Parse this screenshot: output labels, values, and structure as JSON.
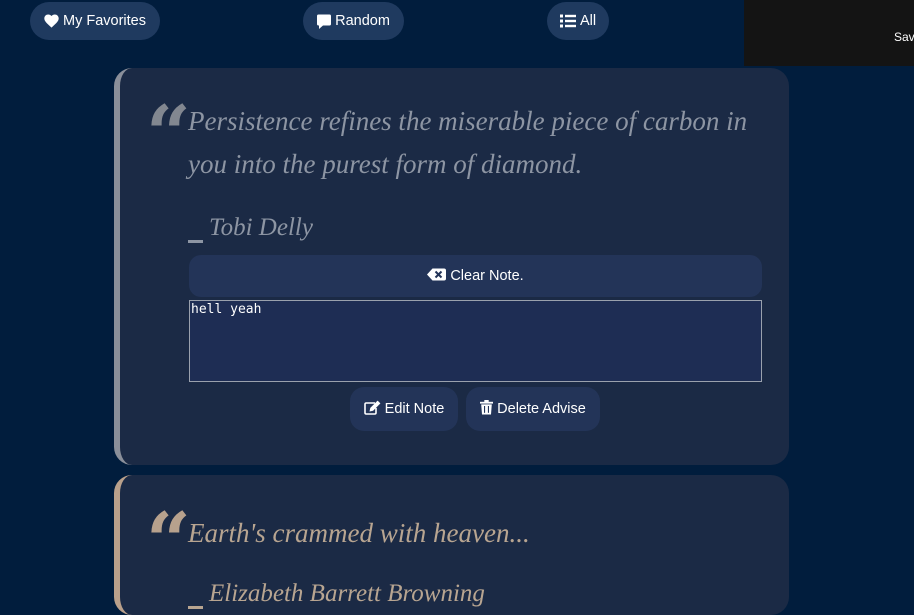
{
  "nav": {
    "favorites_label": "My Favorites",
    "random_label": "Random",
    "all_label": "All"
  },
  "toast": {
    "text": "Saved"
  },
  "cards": [
    {
      "quote": "Persistence refines the miserable piece of carbon in you into the purest form of diamond.",
      "author": "Tobi Delly",
      "clear_note_label": "Clear Note.",
      "note_value": "hell yeah",
      "edit_label": "Edit Note",
      "delete_label": "Delete Advise"
    },
    {
      "quote": "Earth's crammed with heaven...",
      "author": "Elizabeth Barrett Browning"
    }
  ],
  "colors": {
    "background": "#011d3d",
    "card": "#1b2a45",
    "nav_button": "#1f3a5f",
    "card1_accent": "#8a8f9a",
    "card2_accent": "#b9a08b"
  },
  "icons": {
    "favorites": "heart-icon",
    "random": "comment-icon",
    "all": "list-icon",
    "clear": "backspace-icon",
    "edit": "edit-icon",
    "delete": "trash-icon"
  }
}
